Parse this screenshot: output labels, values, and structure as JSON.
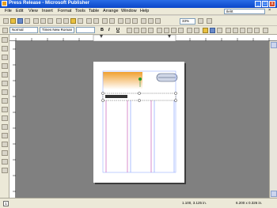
{
  "window": {
    "title": "Press Release - Microsoft Publisher"
  },
  "menu": [
    "File",
    "Edit",
    "View",
    "Insert",
    "Format",
    "Tools",
    "Table",
    "Arrange",
    "Window",
    "Help"
  ],
  "ask_box": {
    "value": "Ilelrt"
  },
  "toolbar": {
    "zoom": "33%"
  },
  "formatting": {
    "style": "Normal",
    "font": "Times New Roman",
    "bold": "B",
    "italic": "I",
    "underline": "U"
  },
  "status": {
    "page_number": "1",
    "position": "1.100, 3.125 in.",
    "size": "6.200 x 0.326 in."
  }
}
